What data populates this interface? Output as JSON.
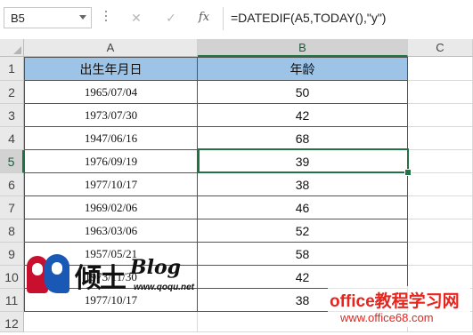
{
  "name_box": {
    "value": "B5"
  },
  "formula_bar": {
    "cancel_glyph": "✕",
    "confirm_glyph": "✓",
    "function_glyph": "fx",
    "formula": "=DATEDIF(A5,TODAY(),\"y\")"
  },
  "columns": [
    "A",
    "B",
    "C"
  ],
  "rows": [
    "1",
    "2",
    "3",
    "4",
    "5",
    "6",
    "7",
    "8",
    "9",
    "10",
    "11",
    "12"
  ],
  "selected_cell": "B5",
  "table": {
    "headers": [
      "出生年月日",
      "年龄"
    ],
    "data": [
      [
        "1965/07/04",
        "50"
      ],
      [
        "1973/07/30",
        "42"
      ],
      [
        "1947/06/16",
        "68"
      ],
      [
        "1976/09/19",
        "39"
      ],
      [
        "1977/10/17",
        "38"
      ],
      [
        "1969/02/06",
        "46"
      ],
      [
        "1963/03/06",
        "52"
      ],
      [
        "1957/05/21",
        "58"
      ],
      [
        "1973/11/30",
        "42"
      ],
      [
        "1977/10/17",
        "38"
      ]
    ]
  },
  "watermarks": {
    "blog_brand": "倾土",
    "blog_word": "Blog",
    "blog_url": "www.qoqu.net",
    "office_title": "office教程学习网",
    "office_url": "www.office68.com"
  },
  "colors": {
    "header_fill": "#9dc3e6",
    "selection": "#217346",
    "watermark_red": "#e8241c"
  }
}
